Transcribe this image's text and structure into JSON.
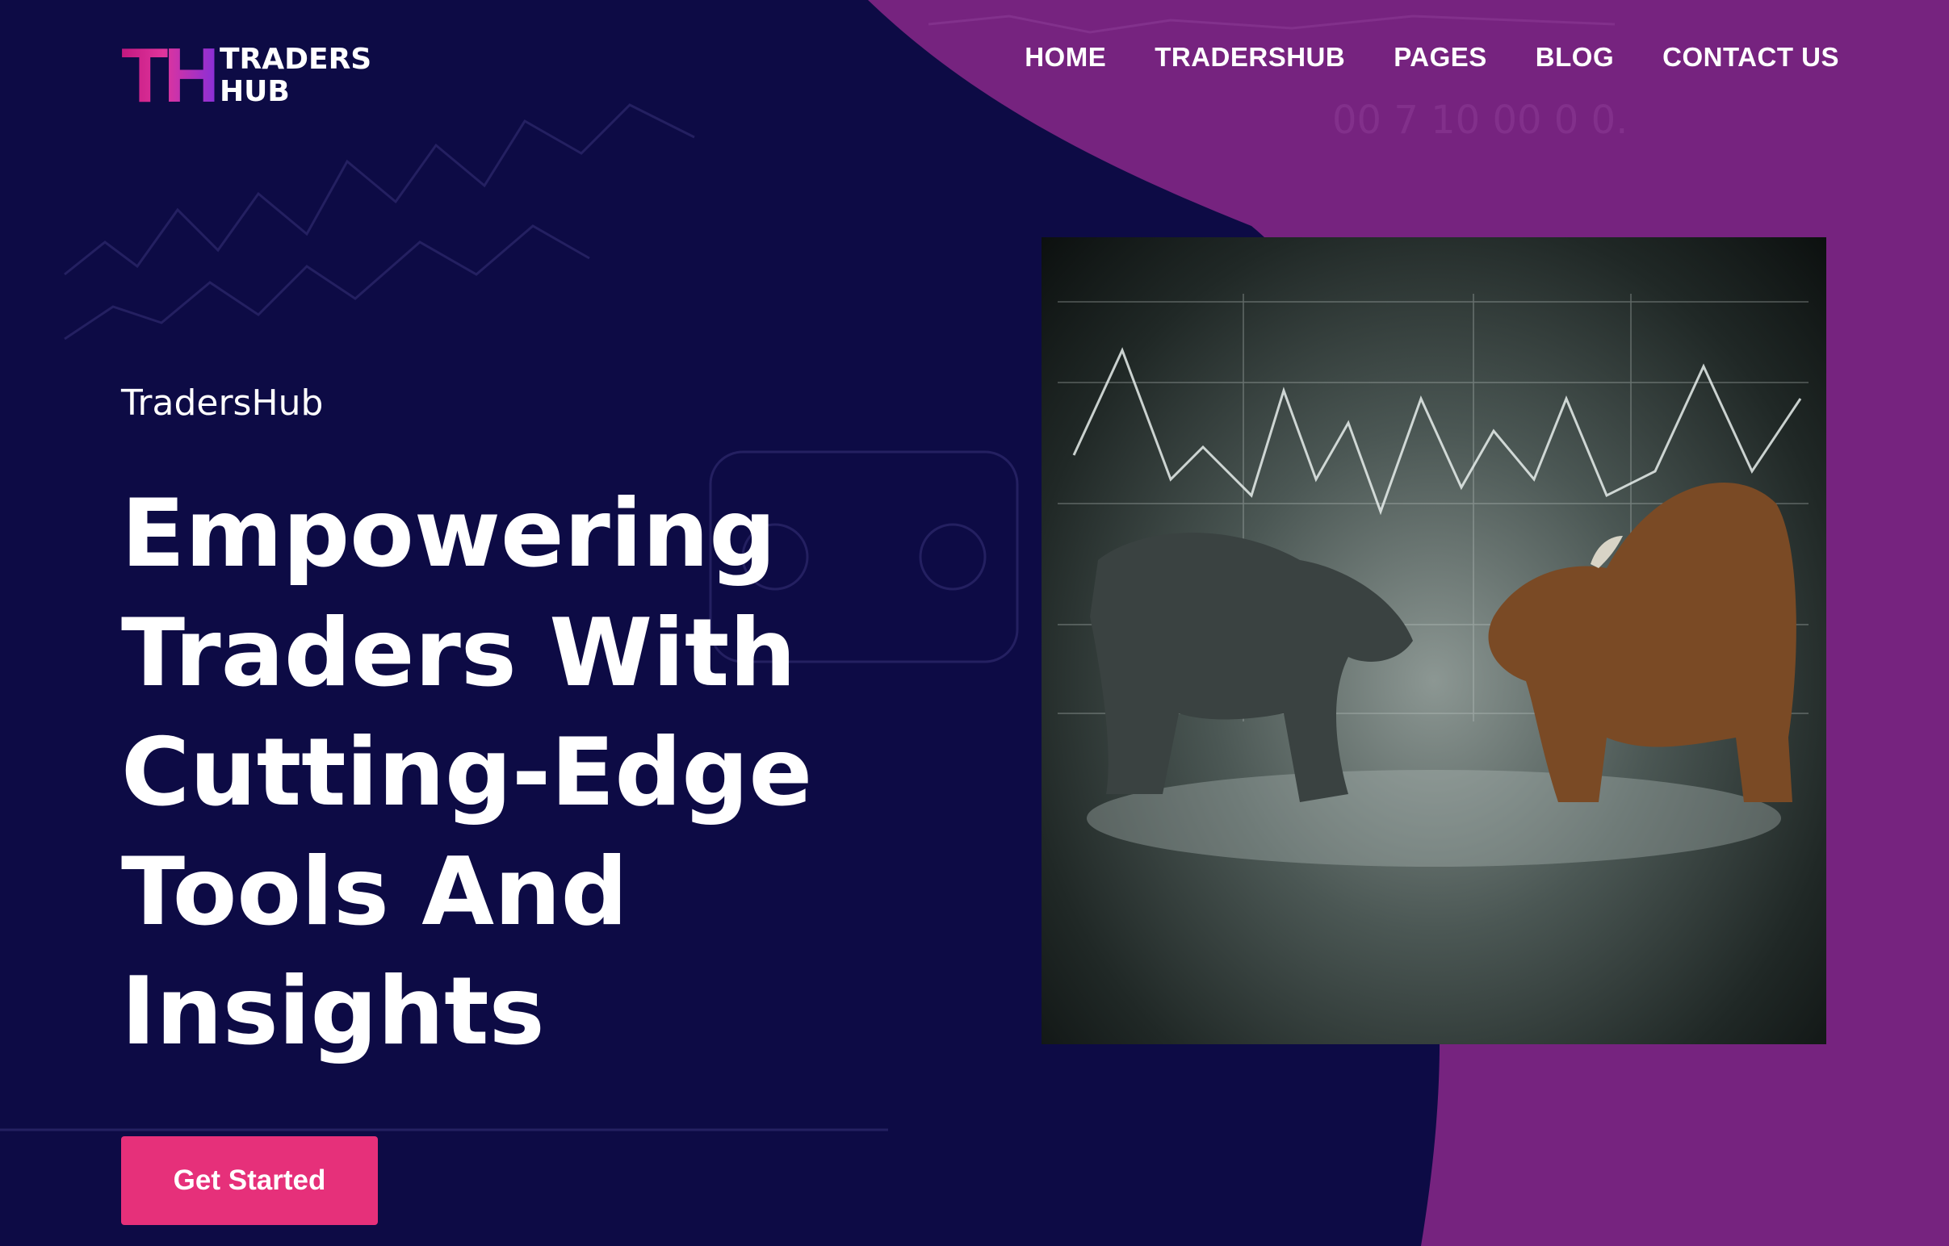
{
  "brand": {
    "logo_mark": "TH",
    "line1": "TRADERS",
    "line2": "HUB"
  },
  "nav": {
    "home": "HOME",
    "tradershub": "TRADERSHUB",
    "pages": "PAGES",
    "blog": "BLOG",
    "contact": "CONTACT US"
  },
  "hero": {
    "eyebrow": "TradersHub",
    "headline": "Empowering Traders With Cutting-Edge Tools And Insights",
    "cta_label": "Get Started"
  },
  "colors": {
    "background_dark": "#0d0b45",
    "background_purple": "#76237f",
    "cta": "#e6307a"
  }
}
